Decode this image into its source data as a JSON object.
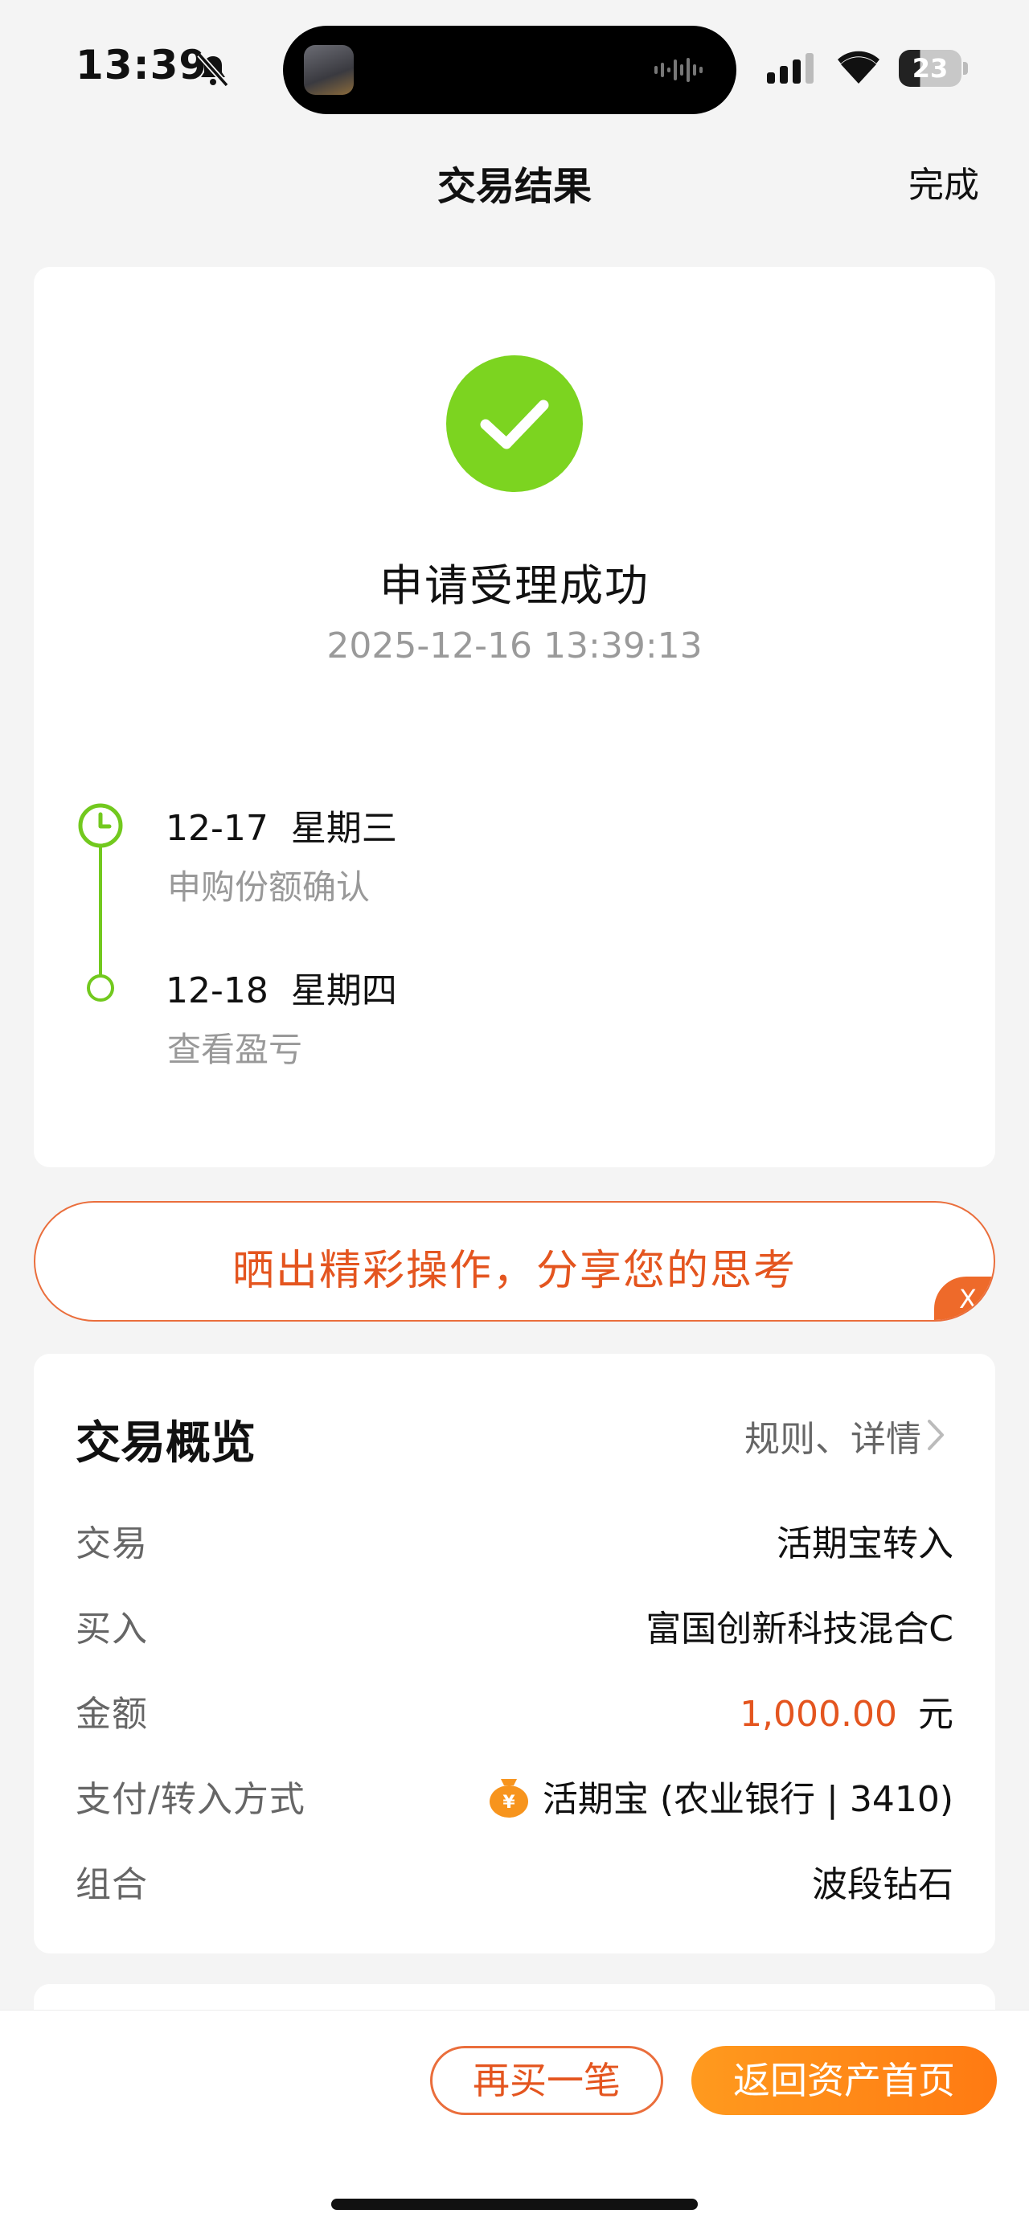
{
  "status_bar": {
    "time": "13:39",
    "battery": "23"
  },
  "nav": {
    "title": "交易结果",
    "done": "完成"
  },
  "result": {
    "title": "申请受理成功",
    "timestamp": "2025-12-16 13:39:13",
    "timeline": [
      {
        "date": "12-17  星期三",
        "desc": "申购份额确认"
      },
      {
        "date": "12-18  星期四",
        "desc": "查看盈亏"
      }
    ]
  },
  "share": {
    "text": "晒出精彩操作，分享您的思考",
    "close": "X"
  },
  "overview": {
    "title": "交易概览",
    "link": "规则、详情",
    "rows": [
      {
        "label": "交易",
        "value": "活期宝转入"
      },
      {
        "label": "买入",
        "value": "富国创新科技混合C"
      },
      {
        "label": "金额",
        "value": "1,000.00",
        "unit": "元"
      },
      {
        "label": "支付/转入方式",
        "value": "活期宝 (农业银行 | 3410)"
      },
      {
        "label": "组合",
        "value": "波段钻石"
      }
    ]
  },
  "actions": {
    "buy_again": "再买一笔",
    "back_home": "返回资产首页"
  },
  "colors": {
    "accent": "#e4551f",
    "success": "#7cd420",
    "primary_button": "#ff8a18"
  }
}
